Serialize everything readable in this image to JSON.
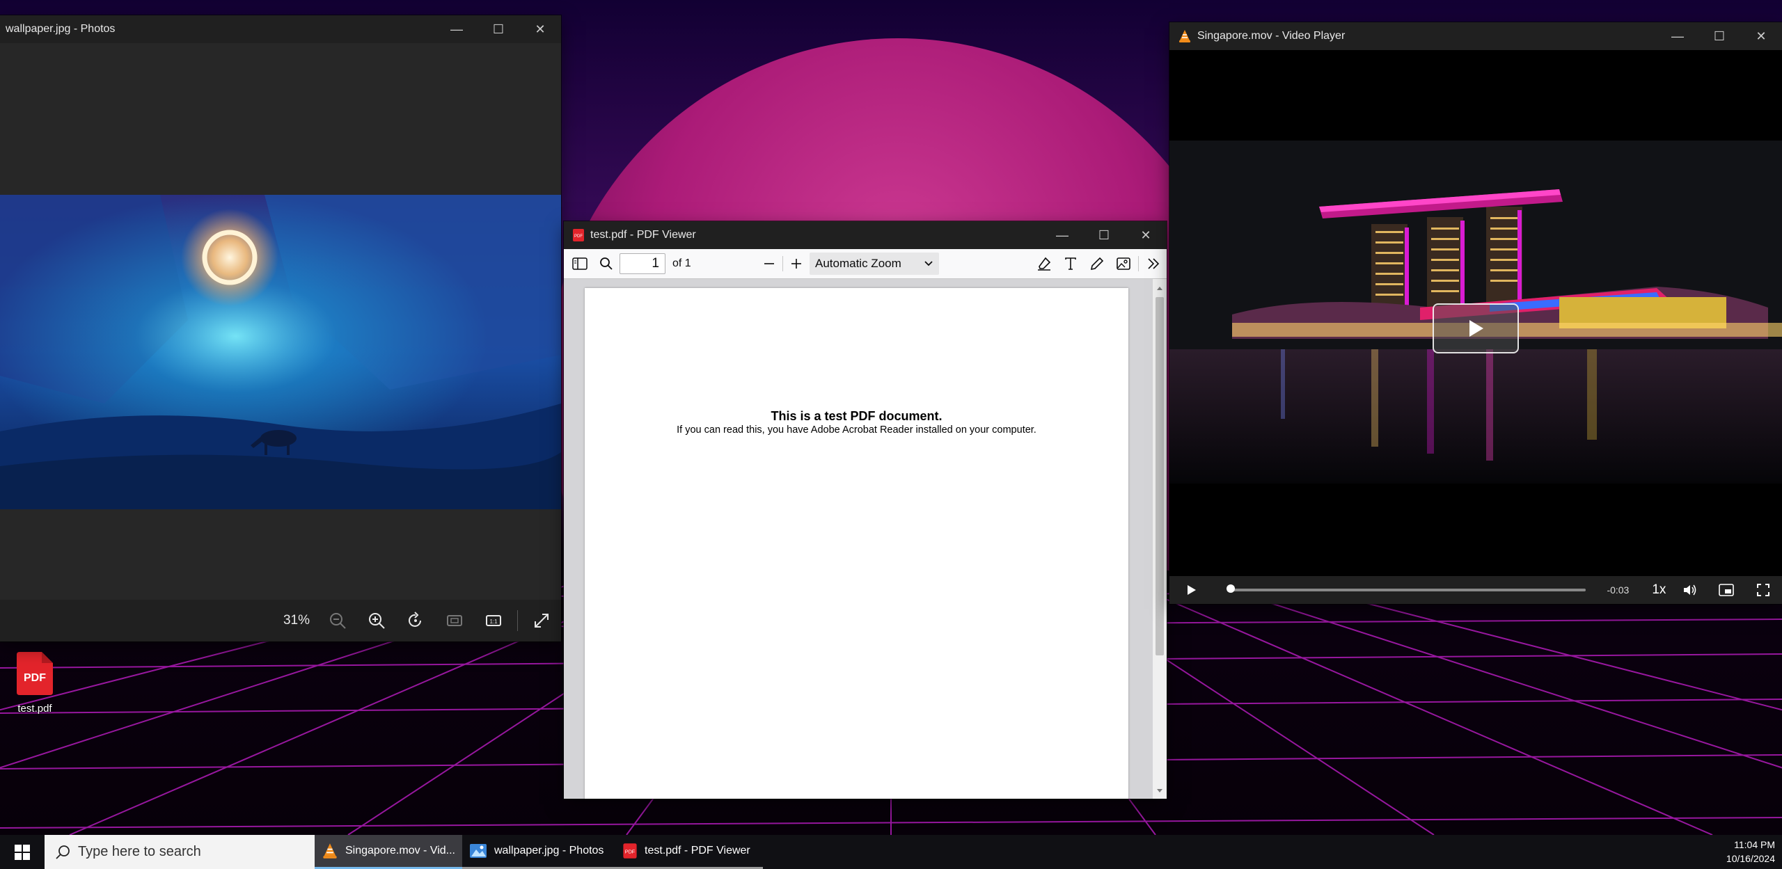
{
  "photos": {
    "title": "wallpaper.jpg - Photos",
    "zoom": "31%"
  },
  "pdf": {
    "title": "test.pdf - PDF Viewer",
    "page_number": "1",
    "page_count": "of 1",
    "zoom": "Automatic Zoom",
    "heading": "This is a test PDF document.",
    "body": "If you can read this, you have Adobe Acrobat Reader installed on your computer."
  },
  "video": {
    "title": "Singapore.mov - Video Player",
    "time_remaining": "-0:03",
    "speed": "1x",
    "progress": 0.01
  },
  "desktop": {
    "icon_label": "test.pdf",
    "icon_text": "PDF"
  },
  "taskbar": {
    "search_placeholder": "Type here to search",
    "apps": [
      {
        "label": "Singapore.mov - Vid..."
      },
      {
        "label": "wallpaper.jpg - Photos"
      },
      {
        "label": "test.pdf - PDF Viewer"
      }
    ],
    "time": "11:04 PM",
    "date": "10/16/2024"
  },
  "colors": {
    "pdf_red": "#e3242b",
    "vlc_orange": "#f28c1a",
    "taskbar_accent": "#76b9ed"
  }
}
